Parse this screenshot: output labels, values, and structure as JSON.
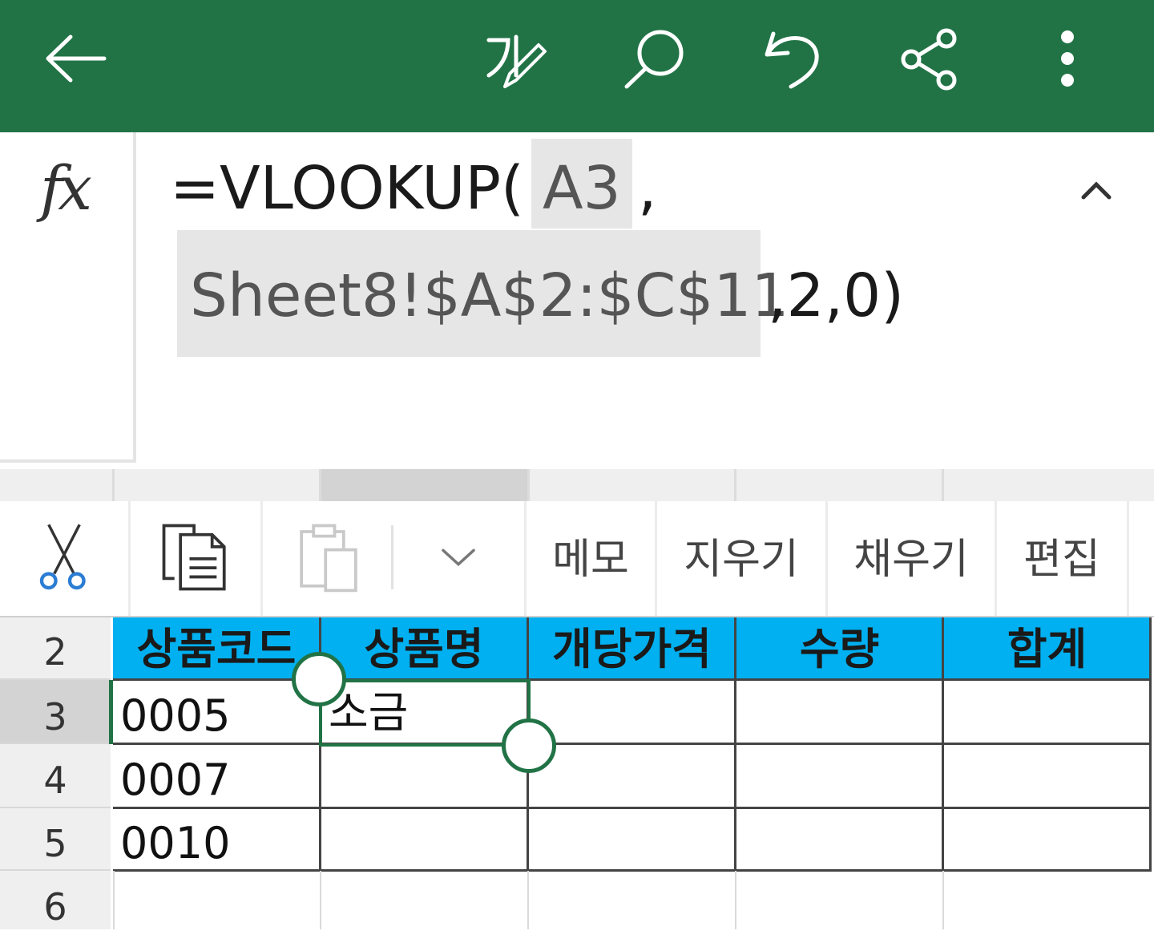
{
  "toolbar": {
    "icons": [
      "back-arrow-icon",
      "handwriting-icon",
      "search-icon",
      "undo-icon",
      "share-icon",
      "more-options-icon"
    ]
  },
  "formula_bar": {
    "fx_label": "fx",
    "part_func": "=VLOOKUP(",
    "part_ref1": "A3",
    "part_comma": ",",
    "part_ref2": "Sheet8!$A$2:$C$11",
    "part_tail": ",2,0)"
  },
  "context_menu": {
    "cut_icon": "scissors-icon",
    "copy_icon": "copy-icon",
    "paste_icon": "paste-icon",
    "dropdown_icon": "chevron-down-icon",
    "memo": "메모",
    "clear": "지우기",
    "fill": "채우기",
    "edit": "편집"
  },
  "grid": {
    "row_numbers": [
      "2",
      "3",
      "4",
      "5",
      "6"
    ],
    "headers": [
      "상품코드",
      "상품명",
      "개당가격",
      "수량",
      "합계"
    ],
    "rows": [
      {
        "code": "0005",
        "name": "소금"
      },
      {
        "code": "0007",
        "name": ""
      },
      {
        "code": "0010",
        "name": ""
      }
    ]
  },
  "colors": {
    "brand_green": "#217346",
    "header_fill": "#00b0f0"
  }
}
